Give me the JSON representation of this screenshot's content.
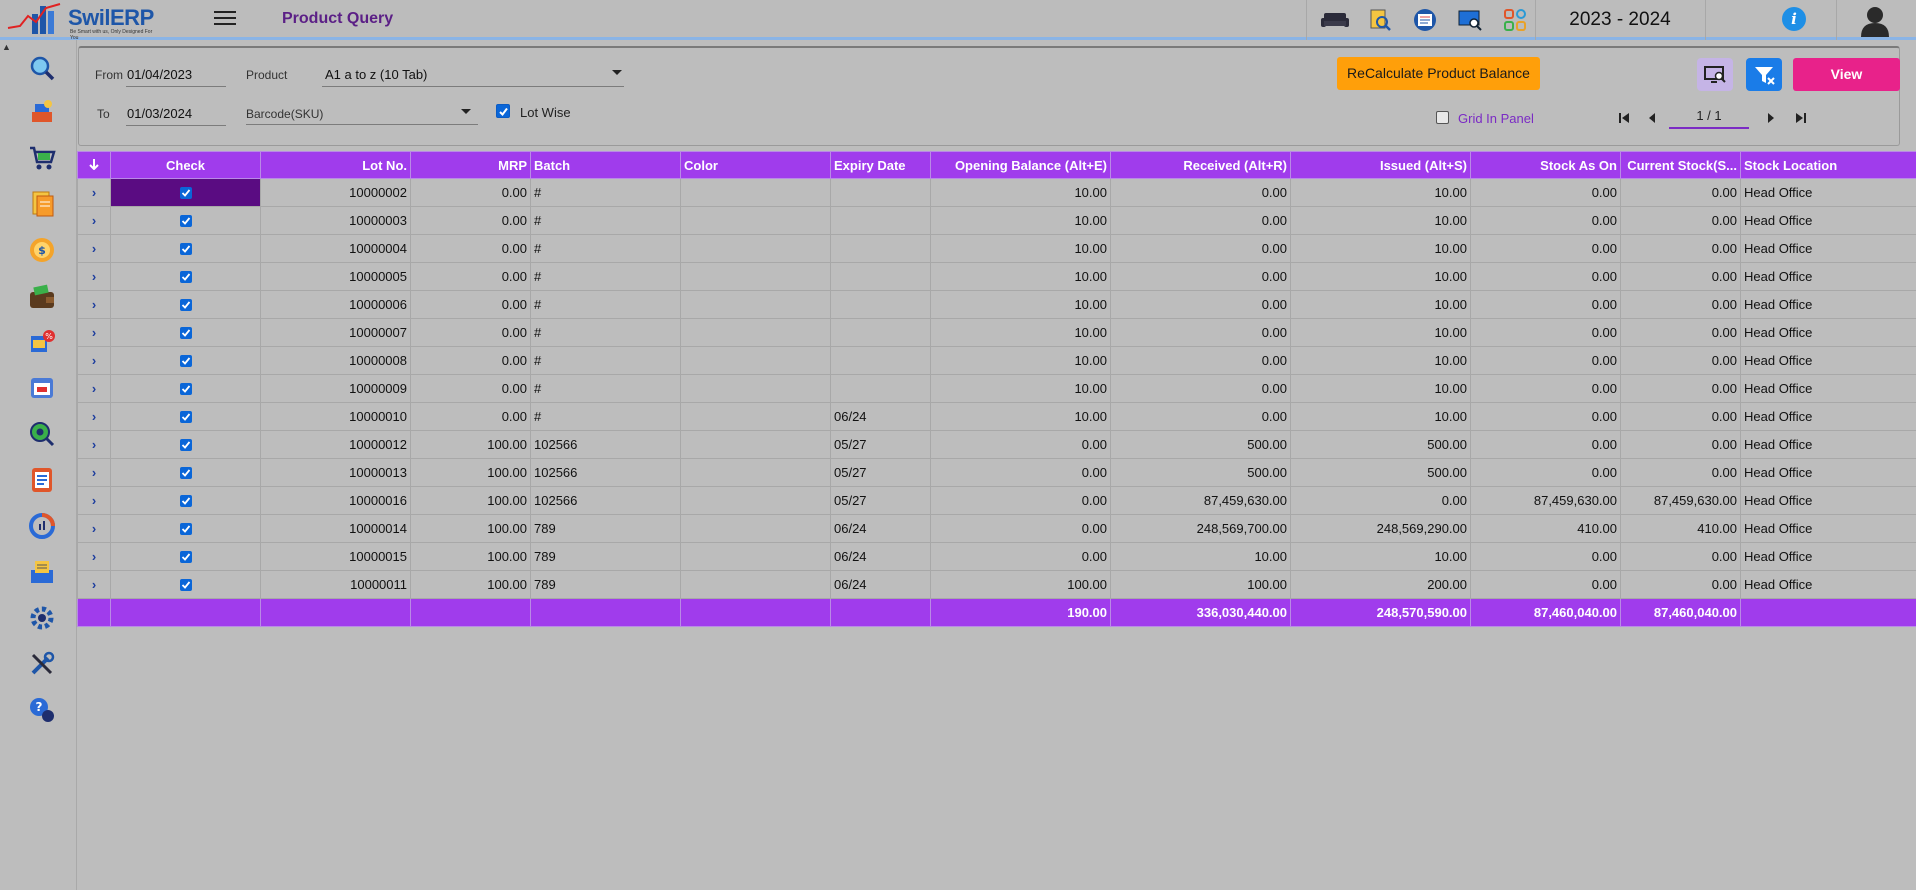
{
  "app": {
    "logo_text": "SwilERP",
    "logo_tagline": "Be Smart with us, Only Designed For You",
    "page_title": "Product Query",
    "financial_year": "2023 - 2024",
    "info_icon": "i"
  },
  "toolbar_icons": [
    "sofa-icon",
    "search-document-icon",
    "report-icon",
    "monitor-search-icon",
    "apps-grid-icon"
  ],
  "sidebar_icons": [
    "search-icon",
    "purchase-icon",
    "cart-icon",
    "documents-icon",
    "payment-icon",
    "wallet-icon",
    "badge-icon",
    "calendar-icon",
    "view-icon",
    "register-icon",
    "chart-icon",
    "inbox-icon",
    "settings-icon",
    "tools-icon",
    "help-icon"
  ],
  "filters": {
    "from_label": "From",
    "from_value": "01/04/2023",
    "to_label": "To",
    "to_value": "01/03/2024",
    "product_label": "Product",
    "product_value": "A1 a to z (10 Tab)",
    "barcode_label": "Barcode(SKU)",
    "barcode_value": "",
    "lot_wise_label": "Lot Wise",
    "lot_wise_checked": true,
    "grid_in_panel_label": "Grid In Panel",
    "grid_in_panel_checked": false
  },
  "buttons": {
    "recalculate": "ReCalculate Product Balance",
    "view": "View"
  },
  "pager": {
    "value": "1 / 1"
  },
  "table": {
    "columns": [
      "Check",
      "Lot No.",
      "MRP",
      "Batch",
      "Color",
      "Expiry Date",
      "Opening Balance (Alt+E)",
      "Received (Alt+R)",
      "Issued (Alt+S)",
      "Stock As On",
      "Current Stock(S...",
      "Stock Location"
    ],
    "rows": [
      {
        "lot": "10000002",
        "mrp": "0.00",
        "batch": "#",
        "color": "",
        "expiry": "",
        "opening": "10.00",
        "received": "0.00",
        "issued": "10.00",
        "stock_as_on": "0.00",
        "current": "0.00",
        "location": "Head Office"
      },
      {
        "lot": "10000003",
        "mrp": "0.00",
        "batch": "#",
        "color": "",
        "expiry": "",
        "opening": "10.00",
        "received": "0.00",
        "issued": "10.00",
        "stock_as_on": "0.00",
        "current": "0.00",
        "location": "Head Office"
      },
      {
        "lot": "10000004",
        "mrp": "0.00",
        "batch": "#",
        "color": "",
        "expiry": "",
        "opening": "10.00",
        "received": "0.00",
        "issued": "10.00",
        "stock_as_on": "0.00",
        "current": "0.00",
        "location": "Head Office"
      },
      {
        "lot": "10000005",
        "mrp": "0.00",
        "batch": "#",
        "color": "",
        "expiry": "",
        "opening": "10.00",
        "received": "0.00",
        "issued": "10.00",
        "stock_as_on": "0.00",
        "current": "0.00",
        "location": "Head Office"
      },
      {
        "lot": "10000006",
        "mrp": "0.00",
        "batch": "#",
        "color": "",
        "expiry": "",
        "opening": "10.00",
        "received": "0.00",
        "issued": "10.00",
        "stock_as_on": "0.00",
        "current": "0.00",
        "location": "Head Office"
      },
      {
        "lot": "10000007",
        "mrp": "0.00",
        "batch": "#",
        "color": "",
        "expiry": "",
        "opening": "10.00",
        "received": "0.00",
        "issued": "10.00",
        "stock_as_on": "0.00",
        "current": "0.00",
        "location": "Head Office"
      },
      {
        "lot": "10000008",
        "mrp": "0.00",
        "batch": "#",
        "color": "",
        "expiry": "",
        "opening": "10.00",
        "received": "0.00",
        "issued": "10.00",
        "stock_as_on": "0.00",
        "current": "0.00",
        "location": "Head Office"
      },
      {
        "lot": "10000009",
        "mrp": "0.00",
        "batch": "#",
        "color": "",
        "expiry": "",
        "opening": "10.00",
        "received": "0.00",
        "issued": "10.00",
        "stock_as_on": "0.00",
        "current": "0.00",
        "location": "Head Office"
      },
      {
        "lot": "10000010",
        "mrp": "0.00",
        "batch": "#",
        "color": "",
        "expiry": "06/24",
        "opening": "10.00",
        "received": "0.00",
        "issued": "10.00",
        "stock_as_on": "0.00",
        "current": "0.00",
        "location": "Head Office"
      },
      {
        "lot": "10000012",
        "mrp": "100.00",
        "batch": "102566",
        "color": "",
        "expiry": "05/27",
        "opening": "0.00",
        "received": "500.00",
        "issued": "500.00",
        "stock_as_on": "0.00",
        "current": "0.00",
        "location": "Head Office"
      },
      {
        "lot": "10000013",
        "mrp": "100.00",
        "batch": "102566",
        "color": "",
        "expiry": "05/27",
        "opening": "0.00",
        "received": "500.00",
        "issued": "500.00",
        "stock_as_on": "0.00",
        "current": "0.00",
        "location": "Head Office"
      },
      {
        "lot": "10000016",
        "mrp": "100.00",
        "batch": "102566",
        "color": "",
        "expiry": "05/27",
        "opening": "0.00",
        "received": "87,459,630.00",
        "issued": "0.00",
        "stock_as_on": "87,459,630.00",
        "current": "87,459,630.00",
        "location": "Head Office"
      },
      {
        "lot": "10000014",
        "mrp": "100.00",
        "batch": "789",
        "color": "",
        "expiry": "06/24",
        "opening": "0.00",
        "received": "248,569,700.00",
        "issued": "248,569,290.00",
        "stock_as_on": "410.00",
        "current": "410.00",
        "location": "Head Office"
      },
      {
        "lot": "10000015",
        "mrp": "100.00",
        "batch": "789",
        "color": "",
        "expiry": "06/24",
        "opening": "0.00",
        "received": "10.00",
        "issued": "10.00",
        "stock_as_on": "0.00",
        "current": "0.00",
        "location": "Head Office"
      },
      {
        "lot": "10000011",
        "mrp": "100.00",
        "batch": "789",
        "color": "",
        "expiry": "06/24",
        "opening": "100.00",
        "received": "100.00",
        "issued": "200.00",
        "stock_as_on": "0.00",
        "current": "0.00",
        "location": "Head Office"
      }
    ],
    "totals": {
      "opening": "190.00",
      "received": "336,030,440.00",
      "issued": "248,570,590.00",
      "stock_as_on": "87,460,040.00",
      "current": "87,460,040.00"
    }
  },
  "colors": {
    "accent": "#a03cec",
    "selected_cell": "#5a0c82",
    "recalc": "#ff9f0a",
    "view": "#e8228a",
    "title": "#5b1f86"
  }
}
